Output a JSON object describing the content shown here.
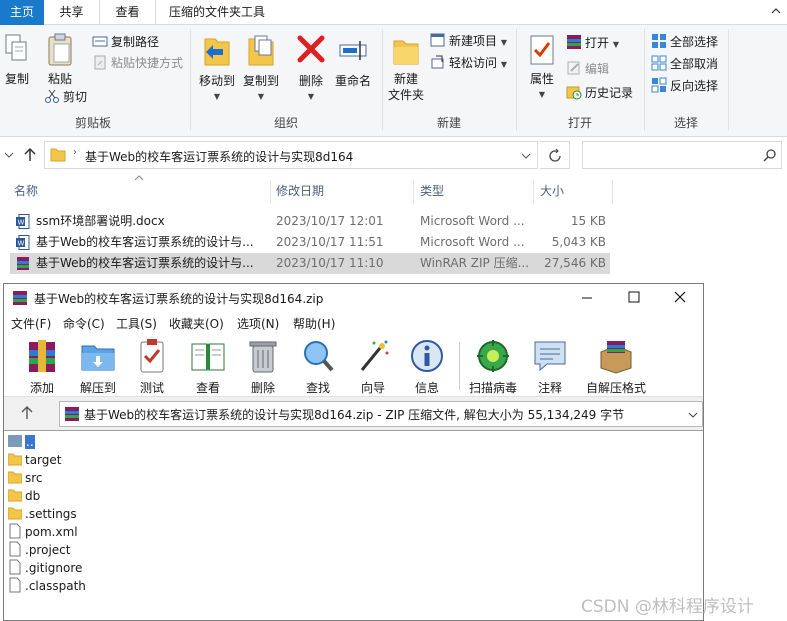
{
  "explorer": {
    "tabs": [
      "主页",
      "共享",
      "查看",
      "压缩的文件夹工具"
    ],
    "ribbon": {
      "clipboard": {
        "copy": "复制",
        "paste": "粘贴",
        "copy_path": "复制路径",
        "paste_shortcut": "粘贴快捷方式",
        "cut": "剪切",
        "label": "剪贴板"
      },
      "organize": {
        "move_to": "移动到",
        "copy_to": "复制到",
        "delete": "删除",
        "rename": "重命名",
        "label": "组织"
      },
      "new": {
        "new_folder_line1": "新建",
        "new_folder_line2": "文件夹",
        "new_item": "新建项目",
        "easy_access": "轻松访问",
        "label": "新建"
      },
      "open": {
        "properties": "属性",
        "open": "打开",
        "edit": "编辑",
        "history": "历史记录",
        "label": "打开"
      },
      "select": {
        "select_all": "全部选择",
        "select_none": "全部取消",
        "invert": "反向选择",
        "label": "选择"
      }
    },
    "address": {
      "path": "基于Web的校车客运订票系统的设计与实现8d164"
    },
    "columns": {
      "name": "名称",
      "date": "修改日期",
      "type": "类型",
      "size": "大小"
    },
    "files": [
      {
        "name": "ssm环境部署说明.docx",
        "date": "2023/10/17 12:01",
        "type": "Microsoft Word ...",
        "size": "15 KB",
        "icon": "word-doc-icon"
      },
      {
        "name": "基于Web的校车客运订票系统的设计与...",
        "date": "2023/10/17 11:51",
        "type": "Microsoft Word ...",
        "size": "5,043 KB",
        "icon": "word-doc-icon"
      },
      {
        "name": "基于Web的校车客运订票系统的设计与...",
        "date": "2023/10/17 11:10",
        "type": "WinRAR ZIP 压缩...",
        "size": "27,546 KB",
        "icon": "winrar-zip-icon"
      }
    ]
  },
  "winrar": {
    "title": "基于Web的校车客运订票系统的设计与实现8d164.zip",
    "menu": [
      "文件(F)",
      "命令(C)",
      "工具(S)",
      "收藏夹(O)",
      "选项(N)",
      "帮助(H)"
    ],
    "toolbar": [
      "添加",
      "解压到",
      "测试",
      "查看",
      "删除",
      "查找",
      "向导",
      "信息",
      "扫描病毒",
      "注释",
      "自解压格式"
    ],
    "path_text": "基于Web的校车客运订票系统的设计与实现8d164.zip - ZIP 压缩文件, 解包大小为 55,134,249 字节",
    "items": [
      {
        "name": "..",
        "kind": "up"
      },
      {
        "name": "target",
        "kind": "folder"
      },
      {
        "name": "src",
        "kind": "folder"
      },
      {
        "name": "db",
        "kind": "folder"
      },
      {
        "name": ".settings",
        "kind": "folder"
      },
      {
        "name": "pom.xml",
        "kind": "file"
      },
      {
        "name": ".project",
        "kind": "file"
      },
      {
        "name": ".gitignore",
        "kind": "file"
      },
      {
        "name": ".classpath",
        "kind": "file"
      }
    ]
  },
  "watermark": "CSDN @林科程序设计"
}
